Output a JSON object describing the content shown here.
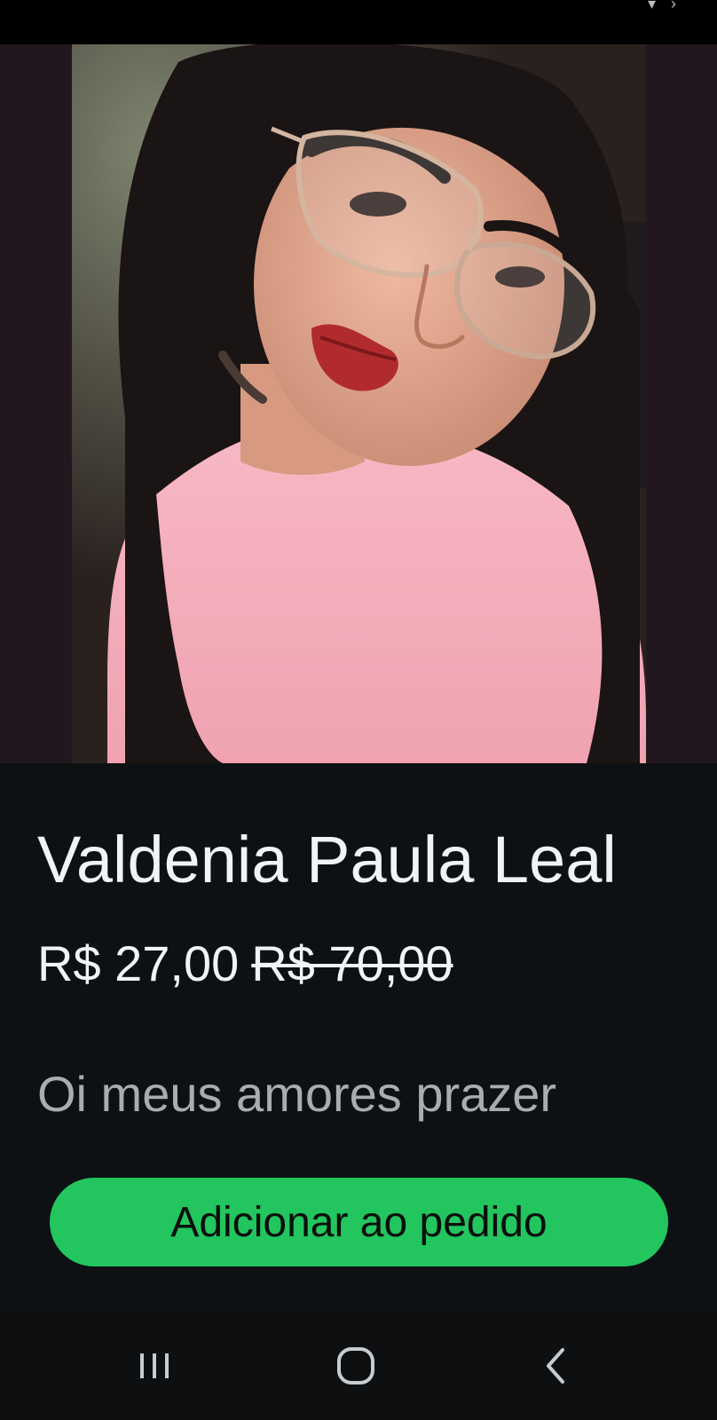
{
  "product": {
    "name": "Valdenia Paula Leal",
    "price_current": "R$ 27,00",
    "price_original": "R$ 70,00",
    "description": "Oi meus amores prazer"
  },
  "actions": {
    "add_to_order_label": "Adicionar ao pedido"
  },
  "photo": {
    "icon": "profile-photo"
  },
  "nav": {
    "recents_icon": "recent-apps-icon",
    "home_icon": "home-icon",
    "back_icon": "back-icon"
  },
  "colors": {
    "background": "#0d1114",
    "accent": "#22c55e",
    "text_primary": "#f1f3f4",
    "text_secondary": "#a8adb2"
  }
}
